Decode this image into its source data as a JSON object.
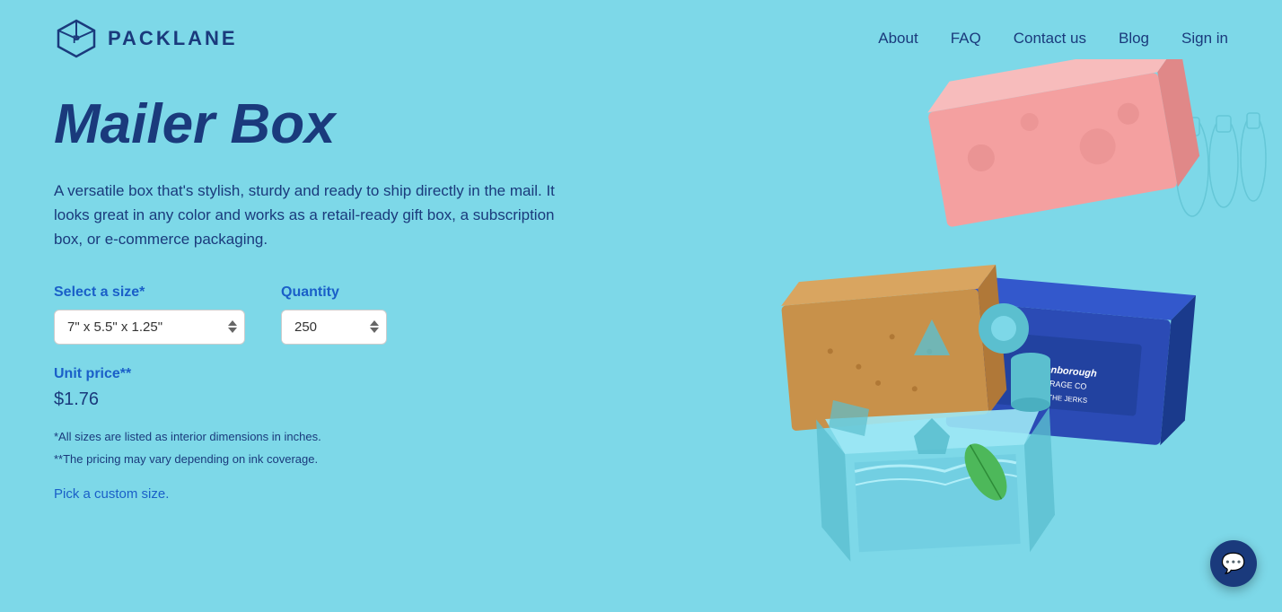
{
  "brand": {
    "name": "PACKLANE",
    "logo_alt": "Packlane logo"
  },
  "nav": {
    "items": [
      {
        "label": "About",
        "href": "#"
      },
      {
        "label": "FAQ",
        "href": "#"
      },
      {
        "label": "Contact us",
        "href": "#"
      },
      {
        "label": "Blog",
        "href": "#"
      },
      {
        "label": "Sign in",
        "href": "#"
      }
    ]
  },
  "hero": {
    "title": "Mailer Box",
    "description": "A versatile box that's stylish, sturdy and ready to ship directly in the mail. It looks great in any color and works as a retail-ready gift box, a subscription box, or e-commerce packaging.",
    "select_size_label": "Select a size*",
    "size_value": "7\" x 5.5\" x 1.25\"",
    "quantity_label": "Quantity",
    "quantity_value": "250",
    "unit_price_label": "Unit price**",
    "price": "$1.76",
    "footnote1": "*All sizes are listed as interior dimensions in inches.",
    "footnote2": "**The pricing may vary depending on ink coverage.",
    "custom_size_link": "Pick a custom size."
  },
  "chat": {
    "label": "Chat"
  },
  "colors": {
    "background": "#7dd8e8",
    "brand_blue": "#1a3a7c",
    "link_blue": "#1a5fc8"
  }
}
